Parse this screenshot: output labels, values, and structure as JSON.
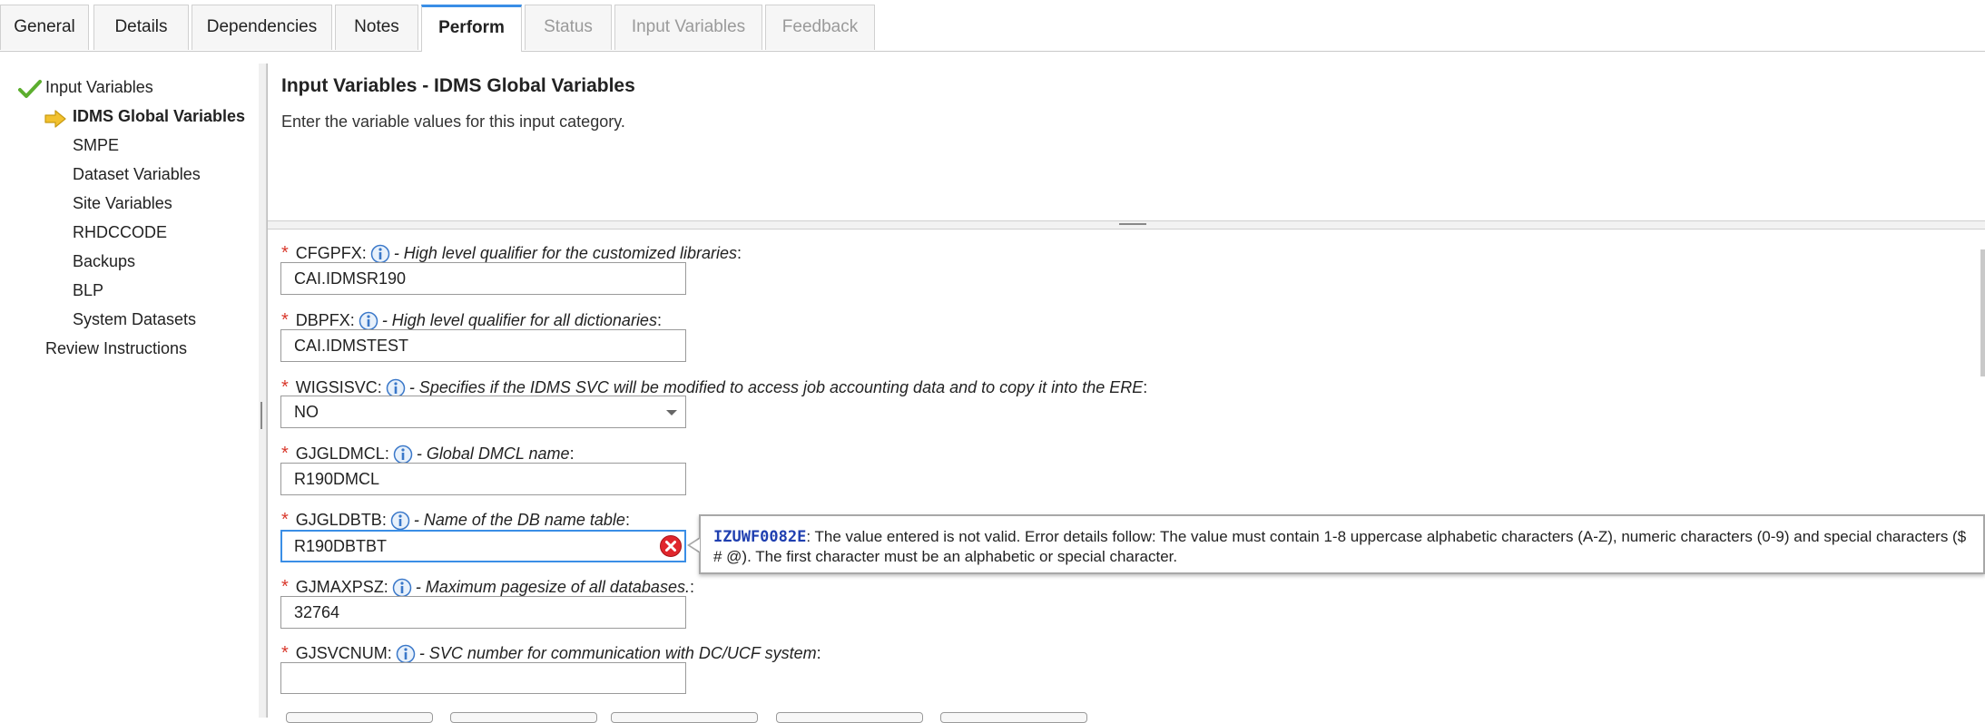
{
  "tabs": [
    {
      "label": "General",
      "state": "normal"
    },
    {
      "label": "Details",
      "state": "normal"
    },
    {
      "label": "Dependencies",
      "state": "normal"
    },
    {
      "label": "Notes",
      "state": "normal"
    },
    {
      "label": "Perform",
      "state": "active"
    },
    {
      "label": "Status",
      "state": "disabled"
    },
    {
      "label": "Input Variables",
      "state": "disabled"
    },
    {
      "label": "Feedback",
      "state": "disabled"
    }
  ],
  "nav": {
    "root": {
      "label": "Input Variables",
      "icon": "check-icon"
    },
    "current": {
      "label": "IDMS Global Variables",
      "icon": "arrow-right-icon"
    },
    "items": [
      "SMPE",
      "Dataset Variables",
      "Site Variables",
      "RHDCCODE",
      "Backups",
      "BLP",
      "System Datasets"
    ],
    "footer": "Review Instructions"
  },
  "header": {
    "title": "Input Variables - IDMS Global Variables",
    "description": "Enter the variable values for this input category."
  },
  "fields": [
    {
      "name": "CFGPFX:",
      "description": "- High level qualifier for the customized libraries",
      "suffix": ":",
      "value": "CAI.IDMSR190",
      "type": "text"
    },
    {
      "name": "DBPFX:",
      "description": "- High level qualifier for all dictionaries",
      "suffix": ":",
      "value": "CAI.IDMSTEST",
      "type": "text"
    },
    {
      "name": "WIGSISVC:",
      "description": "- Specifies if the IDMS SVC will be modified to access job accounting data and to copy it into the ERE",
      "suffix": ":",
      "value": "NO",
      "type": "select"
    },
    {
      "name": "GJGLDMCL:",
      "description": "- Global DMCL name",
      "suffix": ":",
      "value": "R190DMCL",
      "type": "text"
    },
    {
      "name": "GJGLDBTB:",
      "description": "- Name of the DB name table",
      "suffix": ":",
      "value": "R190DBTBT",
      "type": "text",
      "error": true
    },
    {
      "name": "GJMAXPSZ:",
      "description": "- Maximum pagesize of all databases.",
      "suffix": ":",
      "value": "32764",
      "type": "text"
    },
    {
      "name": "GJSVCNUM:",
      "description": "- SVC number for communication with DC/UCF system",
      "suffix": ":",
      "value": "",
      "type": "text"
    }
  ],
  "required_marker": "*",
  "error_tooltip": {
    "code": "IZUWF0082E",
    "message": ": The value entered is not valid. Error details follow: The value must contain 1-8 uppercase alphabetic characters (A-Z), numeric characters (0-9) and special characters ($ # @). The first character must be an alphabetic or special character."
  },
  "colors": {
    "accent": "#3a8ee6",
    "required": "#d9372b",
    "error_icon": "#e0262c",
    "check": "#5cae2e",
    "arrow": "#f2c12e",
    "info_icon": "#3a78c9",
    "error_code": "#1f3fb0"
  }
}
